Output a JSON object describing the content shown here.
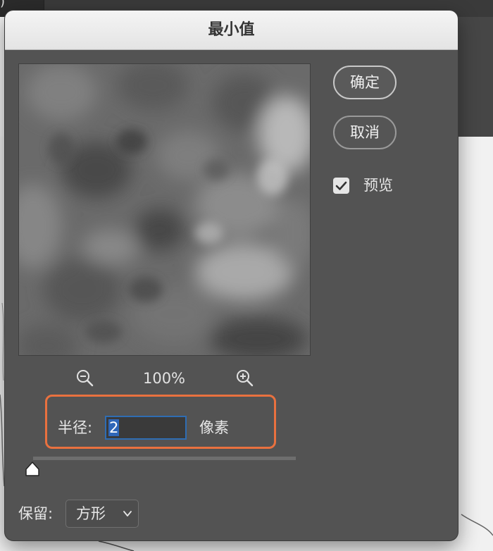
{
  "dialog": {
    "title": "最小值",
    "zoom": {
      "level": "100%"
    },
    "radius": {
      "label": "半径:",
      "value": "2",
      "unit": "像素"
    },
    "slider": {
      "value_fraction": 0.0
    },
    "preserve": {
      "label": "保留:",
      "selected": "方形"
    },
    "buttons": {
      "ok": "确定",
      "cancel": "取消"
    },
    "preview_option": {
      "label": "预览",
      "checked": true
    }
  },
  "colors": {
    "dialog_bg": "#535353",
    "highlight_border": "#e9713f",
    "input_focus": "#2f6db3"
  },
  "icons": [
    "zoom-out-icon",
    "zoom-in-icon",
    "checkmark-icon",
    "chevron-down-icon"
  ]
}
